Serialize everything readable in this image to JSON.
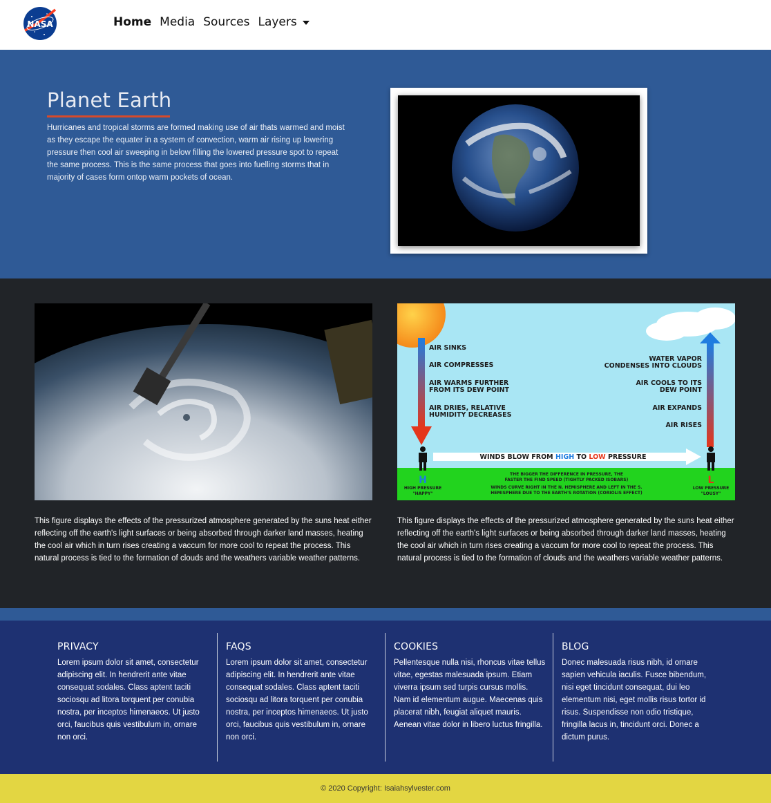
{
  "nav": {
    "logo_text": "NASA",
    "links": [
      "Home",
      "Media",
      "Sources",
      "Layers"
    ]
  },
  "hero": {
    "title": "Planet Earth",
    "text": "Hurricanes and tropical storms are formed making use of air thats warmed and moist as they escape the equater in a system of convection, warm air rising up lowering pressure then cool air sweeping in below filling the lowered pressure spot to repeat the same process. This is the same process that goes into fuelling storms that in majority of cases form ontop warm pockets of ocean."
  },
  "figures": [
    {
      "caption": "This figure displays the effects of the pressurized atmosphere generated by the suns heat either reflecting off the earth's light surfaces or being absorbed through darker land masses, heating the cool air which in turn rises creating a vaccum for more cool to repeat the process. This natural process is tied to the formation of clouds and the weathers variable weather patterns."
    },
    {
      "caption": "This figure displays the effects of the pressurized atmosphere generated by the suns heat either reflecting off the earth's light surfaces or being absorbed through darker land masses, heating the cool air which in turn rises creating a vaccum for more cool to repeat the process. This natural process is tied to the formation of clouds and the weathers variable weather patterns."
    }
  ],
  "diagram": {
    "left": [
      "AIR SINKS",
      "AIR COMPRESSES",
      "AIR WARMS FURTHER",
      "FROM ITS DEW POINT",
      "AIR DRIES, RELATIVE",
      "HUMIDITY DECREASES"
    ],
    "right": [
      "WATER VAPOR",
      "CONDENSES INTO CLOUDS",
      "AIR COOLS TO ITS",
      "DEW POINT",
      "AIR EXPANDS",
      "AIR RISES"
    ],
    "winds_pre": "WINDS BLOW FROM ",
    "winds_high": "HIGH",
    "winds_mid": " TO ",
    "winds_low": "LOW",
    "winds_post": " PRESSURE",
    "h_letter": "H",
    "l_letter": "L",
    "high_label1": "HIGH PRESSURE",
    "high_label2": "\"HAPPY\"",
    "low_label1": "LOW PRESSURE",
    "low_label2": "\"LOUSY\"",
    "note1a": "THE BIGGER THE DIFFERENCE IN PRESSURE, THE",
    "note1b": "FASTER THE FIND SPEED (TIGHTLY PACKED ISOBARS)",
    "note2a": "WINDS CURVE RIGHT IN THE N. HEMISPHERE AND LEFT IN THE S.",
    "note2b": "HEMISPHERE DUE TO THE EARTH'S ROTATION (CORIOLIS EFFECT)",
    "colors": {
      "high": "#1f7de0",
      "low": "#e4361b",
      "sky": "#a9e6f4",
      "ground": "#22d31e"
    }
  },
  "footer": {
    "columns": [
      {
        "title": "PRIVACY",
        "text": "Lorem ipsum dolor sit amet, consectetur adipiscing elit. In hendrerit ante vitae consequat sodales. Class aptent taciti sociosqu ad litora torquent per conubia nostra, per inceptos himenaeos. Ut justo orci, faucibus quis vestibulum in, ornare non orci."
      },
      {
        "title": "FAQS",
        "text": "Lorem ipsum dolor sit amet, consectetur adipiscing elit. In hendrerit ante vitae consequat sodales. Class aptent taciti sociosqu ad litora torquent per conubia nostra, per inceptos himenaeos. Ut justo orci, faucibus quis vestibulum in, ornare non orci."
      },
      {
        "title": "COOKIES",
        "text": "Pellentesque nulla nisi, rhoncus vitae tellus vitae, egestas malesuada ipsum. Etiam viverra ipsum sed turpis cursus mollis. Nam id elementum augue. Maecenas quis placerat nibh, feugiat aliquet mauris. Aenean vitae dolor in libero luctus fringilla."
      },
      {
        "title": "BLOG",
        "text": "Donec malesuada risus nibh, id ornare sapien vehicula iaculis. Fusce bibendum, nisi eget tincidunt consequat, dui leo elementum nisi, eget mollis risus tortor id risus. Suspendisse non odio tristique, fringilla lacus in, tincidunt orci. Donec a dictum purus."
      }
    ],
    "copyright": "© 2020 Copyright: Isaiahsylvester.com"
  },
  "colors": {
    "navbar": "#ffffff",
    "hero": "#2f5a96",
    "dark": "#212428",
    "footer": "#1e3172",
    "copyright_bar": "#e3d642",
    "title_underline": "#d74a2a"
  }
}
